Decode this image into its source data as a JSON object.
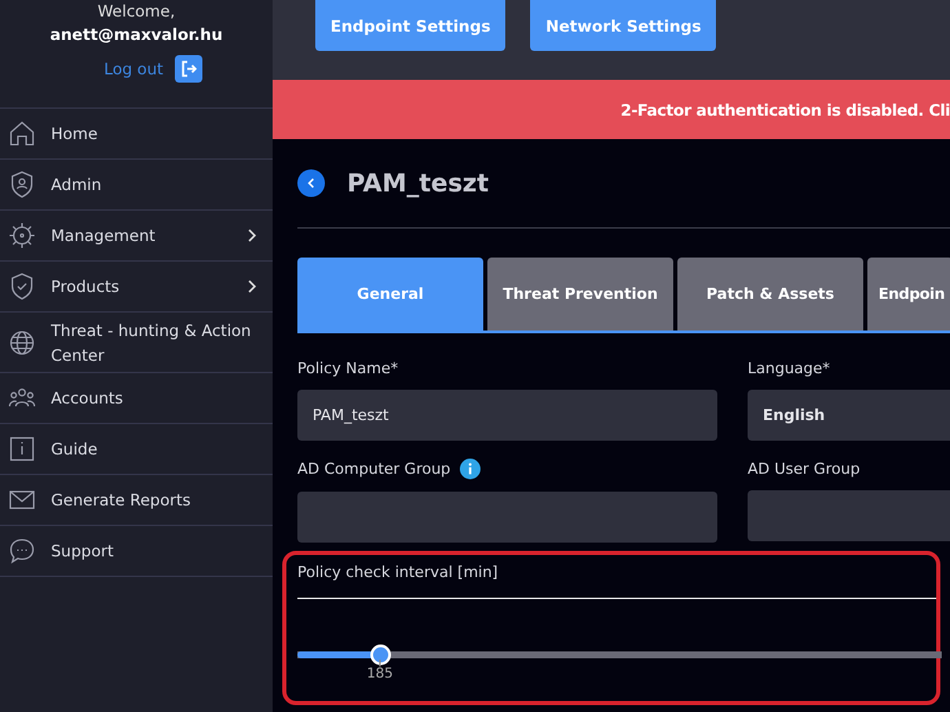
{
  "sidebar": {
    "welcome": "Welcome,",
    "user": "anett@maxvalor.hu",
    "logout": "Log out",
    "items": [
      {
        "label": "Home",
        "has_submenu": false
      },
      {
        "label": "Admin",
        "has_submenu": false
      },
      {
        "label": "Management",
        "has_submenu": true
      },
      {
        "label": "Products",
        "has_submenu": true
      },
      {
        "label": "Threat - hunting & Action Center",
        "has_submenu": false
      },
      {
        "label": "Accounts",
        "has_submenu": false
      },
      {
        "label": "Guide",
        "has_submenu": false
      },
      {
        "label": "Generate Reports",
        "has_submenu": false
      },
      {
        "label": "Support",
        "has_submenu": false
      }
    ]
  },
  "top_buttons": [
    "Endpoint Settings",
    "Network Settings"
  ],
  "banner": "2-Factor authentication is disabled. Cli",
  "page_title": "PAM_teszt",
  "tabs": [
    {
      "label": "General",
      "selected": true
    },
    {
      "label": "Threat Prevention",
      "selected": false
    },
    {
      "label": "Patch & Assets",
      "selected": false
    },
    {
      "label": "Endpoin",
      "selected": false
    }
  ],
  "form": {
    "policy_name": {
      "label": "Policy Name*",
      "value": "PAM_teszt"
    },
    "language": {
      "label": "Language*",
      "value": "English"
    },
    "ad_computer_group": {
      "label": "AD Computer Group"
    },
    "ad_user_group": {
      "label": "AD User Group"
    },
    "interval": {
      "label": "Policy check interval [min]",
      "level": 0.128,
      "reading": "185"
    }
  }
}
